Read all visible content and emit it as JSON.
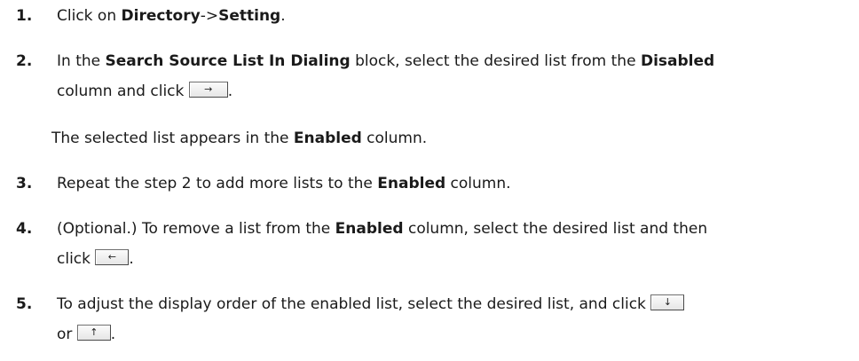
{
  "steps": [
    {
      "number": "1.",
      "parts": [
        "Click on ",
        "Directory",
        "->",
        "Setting",
        "."
      ]
    },
    {
      "number": "2.",
      "line1": [
        "In the ",
        "Search Source List In Dialing",
        " block, select the desired list from the ",
        "Disabled"
      ],
      "line2": [
        "column and click ",
        "."
      ],
      "button": "→"
    },
    {
      "note": [
        "The selected list appears in the ",
        "Enabled",
        " column."
      ]
    },
    {
      "number": "3.",
      "parts": [
        "Repeat the step 2 to add more lists to the ",
        "Enabled",
        " column."
      ]
    },
    {
      "number": "4.",
      "line1": [
        "(Optional.) To remove a list from the ",
        "Enabled",
        " column, select the desired list and then"
      ],
      "line2": [
        "click ",
        "."
      ],
      "button": "←"
    },
    {
      "number": "5.",
      "line1": [
        "To adjust the display order of the enabled list, select the desired list, and click "
      ],
      "line2": [
        "or ",
        "."
      ],
      "button_down": "↓",
      "button_up": "↑"
    }
  ]
}
